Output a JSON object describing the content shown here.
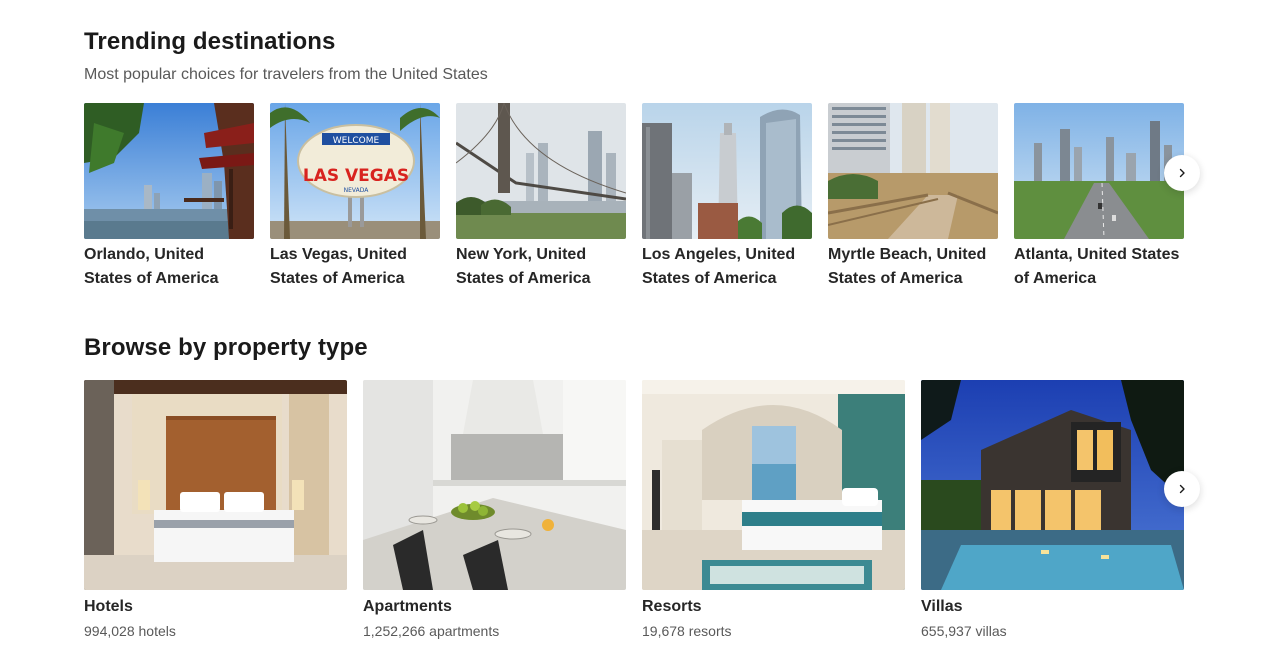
{
  "trending": {
    "title": "Trending destinations",
    "subtitle": "Most popular choices for travelers from the United States",
    "next_icon": "chevron-right-icon",
    "destinations": [
      {
        "name": "Orlando, United States of America",
        "image": "Orlando lake with pagoda"
      },
      {
        "name": "Las Vegas, United States of America",
        "image": "Welcome to Fabulous Las Vegas sign"
      },
      {
        "name": "New York, United States of America",
        "image": "Brooklyn Bridge and skyline"
      },
      {
        "name": "Los Angeles, United States of America",
        "image": "Downtown skyscrapers"
      },
      {
        "name": "Myrtle Beach, United States of America",
        "image": "Boardwalk and hotels"
      },
      {
        "name": "Atlanta, United States of America",
        "image": "Highway and skyline"
      }
    ]
  },
  "property_types": {
    "title": "Browse by property type",
    "next_icon": "chevron-right-icon",
    "types": [
      {
        "name": "Hotels",
        "count": "994,028 hotels"
      },
      {
        "name": "Apartments",
        "count": "1,252,266 apartments"
      },
      {
        "name": "Resorts",
        "count": "19,678 resorts"
      },
      {
        "name": "Villas",
        "count": "655,937 villas"
      }
    ]
  }
}
